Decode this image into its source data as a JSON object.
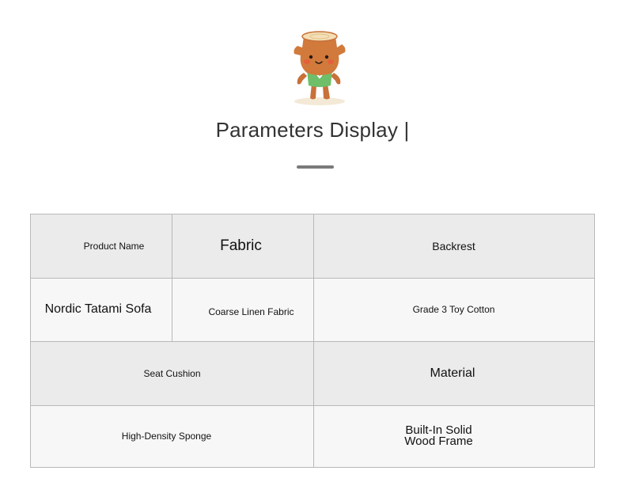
{
  "title": "Parameters Display |",
  "mascot": {
    "icon": "tree-stump-mascot-icon"
  },
  "table": {
    "row1": {
      "product_name_label": "Product Name",
      "fabric_label": "Fabric",
      "backrest_label": "Backrest"
    },
    "row2": {
      "product_name_value": "Nordic Tatami Sofa",
      "fabric_value": "Coarse Linen Fabric",
      "backrest_value": "Grade 3 Toy Cotton"
    },
    "row3": {
      "seat_cushion_label": "Seat Cushion",
      "material_label": "Material"
    },
    "row4": {
      "seat_cushion_value": "High-Density Sponge",
      "material_value_line1": "Built-In Solid",
      "material_value_line2": "Wood Frame"
    }
  },
  "colors": {
    "header_row": "#ebebeb",
    "value_row": "#f7f7f7",
    "border": "#b8b8b8",
    "title_text": "#333333",
    "underline": "#7a7a7a"
  }
}
